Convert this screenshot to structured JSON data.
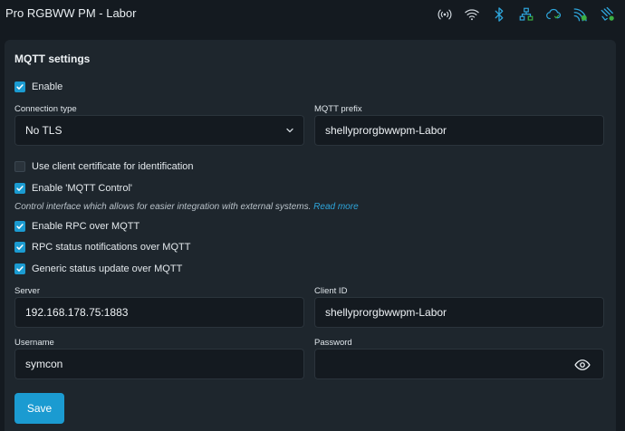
{
  "app": {
    "title": "Pro RGBWW PM - Labor"
  },
  "status_icons": [
    "signal-icon",
    "wifi-icon",
    "bluetooth-icon",
    "ethernet-icon",
    "cloud-icon",
    "mqtt-icon",
    "ws-icon"
  ],
  "mqtt": {
    "title": "MQTT settings",
    "enable_label": "Enable",
    "connection_type_label": "Connection type",
    "connection_type_value": "No TLS",
    "prefix_label": "MQTT prefix",
    "prefix_value": "shellyprorgbwwpm-Labor",
    "client_cert_label": "Use client certificate for identification",
    "mqtt_control_label": "Enable 'MQTT Control'",
    "hint_text": "Control interface which allows for easier integration with external systems.",
    "read_more": "Read more",
    "rpc_label": "Enable RPC over MQTT",
    "rpc_status_label": "RPC status notifications over MQTT",
    "generic_status_label": "Generic status update over MQTT",
    "server_label": "Server",
    "server_value": "192.168.178.75:1883",
    "client_id_label": "Client ID",
    "client_id_value": "shellyprorgbwwpm-Labor",
    "username_label": "Username",
    "username_value": "symcon",
    "password_label": "Password",
    "password_value": "",
    "save_label": "Save"
  },
  "colors": {
    "accent": "#1b9bd1",
    "background": "#141a20",
    "panel": "#1e262d",
    "green": "#3cb043"
  }
}
